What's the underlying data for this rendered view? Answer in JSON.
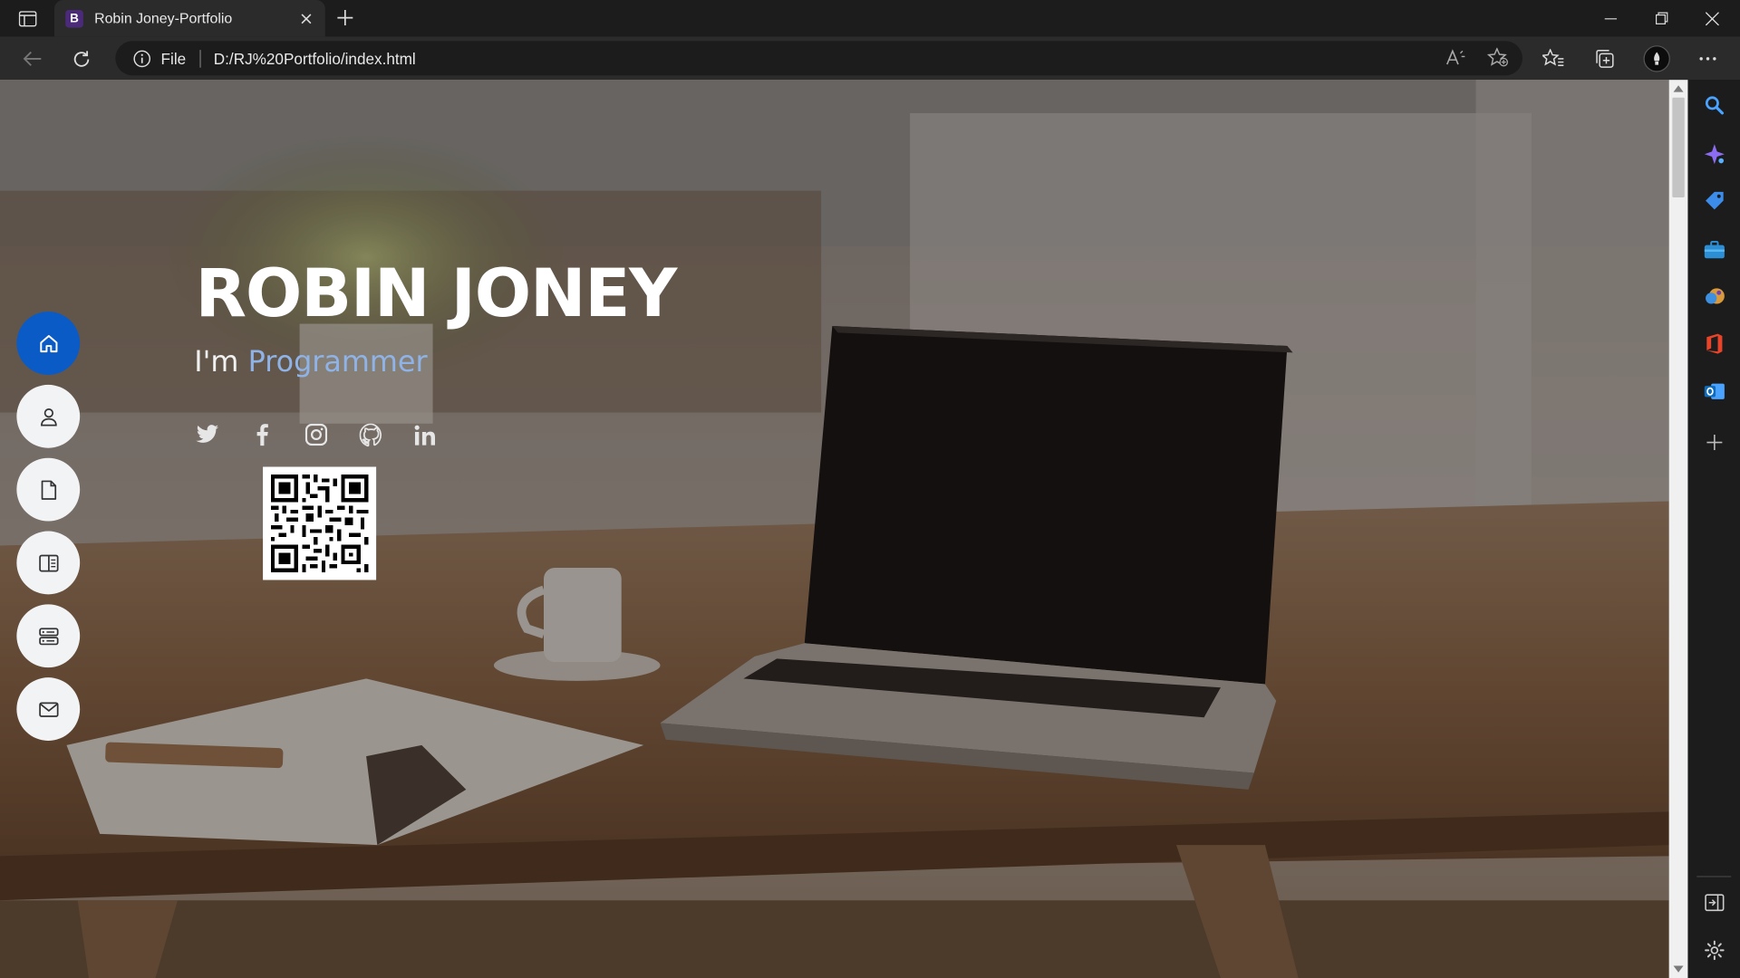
{
  "browser": {
    "tab": {
      "favicon_letter": "B",
      "title": "Robin Joney-Portfolio"
    },
    "address": {
      "scheme_label": "File",
      "url": "D:/RJ%20Portfolio/index.html"
    },
    "accent_color": "#0b5bc7"
  },
  "page": {
    "hero": {
      "name": "ROBIN JONEY",
      "prefix": "I'm ",
      "typed_role": "Programmer"
    },
    "socials": [
      "twitter-icon",
      "facebook-icon",
      "instagram-icon",
      "github-icon",
      "linkedin-icon"
    ],
    "side_nav": [
      {
        "name": "home",
        "icon": "home-icon",
        "active": true
      },
      {
        "name": "about",
        "icon": "person-icon",
        "active": false
      },
      {
        "name": "resume",
        "icon": "file-icon",
        "active": false
      },
      {
        "name": "portfolio",
        "icon": "book-icon",
        "active": false
      },
      {
        "name": "services",
        "icon": "server-icon",
        "active": false
      },
      {
        "name": "contact",
        "icon": "envelope-icon",
        "active": false
      }
    ]
  },
  "edge_sidebar": [
    "search-icon",
    "copilot-icon",
    "shopping-icon",
    "tools-icon",
    "games-icon",
    "office-icon",
    "outlook-icon",
    "add-icon",
    "hide-sidebar-icon",
    "settings-icon"
  ]
}
